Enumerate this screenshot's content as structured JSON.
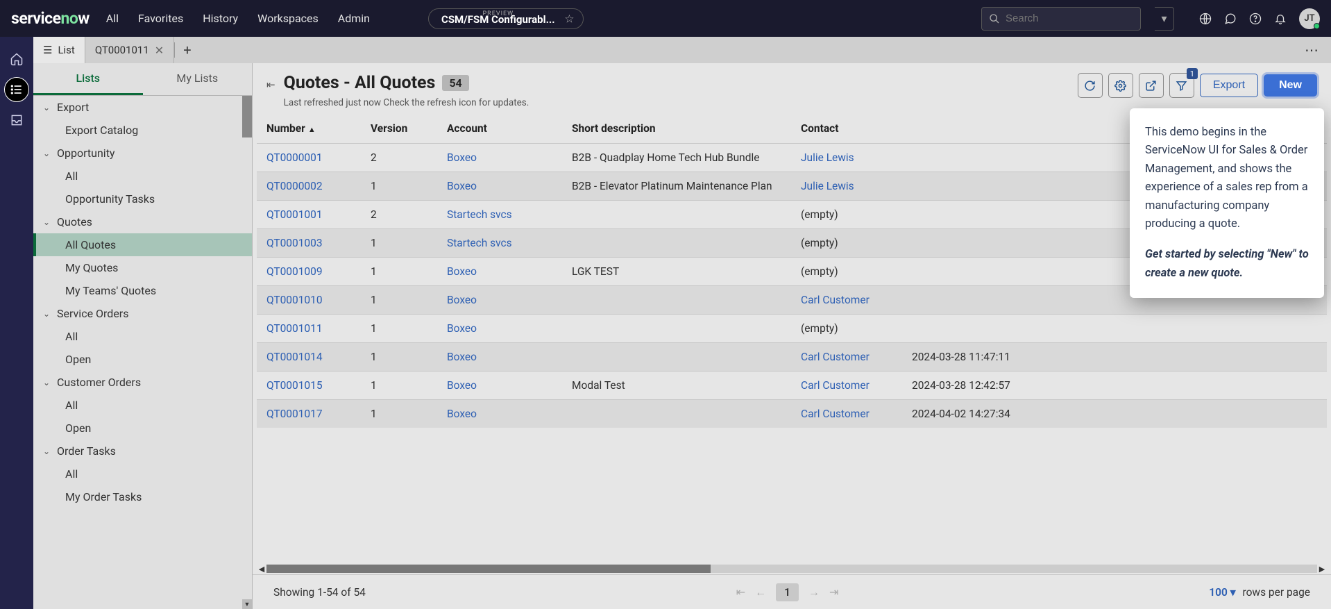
{
  "brand": {
    "name_left": "service",
    "name_right": "w",
    "accent": "no"
  },
  "nav": [
    "All",
    "Favorites",
    "History",
    "Workspaces",
    "Admin"
  ],
  "workspace": {
    "preview": "PREVIEW",
    "title": "CSM/FSM Configurabl..."
  },
  "search": {
    "placeholder": "Search"
  },
  "avatar": "JT",
  "tabs": [
    {
      "label": "List",
      "active": true,
      "icon": true
    },
    {
      "label": "QT0001011",
      "active": false,
      "closeable": true
    }
  ],
  "side_tabs": {
    "lists": "Lists",
    "my_lists": "My Lists"
  },
  "tree": [
    {
      "label": "Export",
      "type": "group"
    },
    {
      "label": "Export Catalog",
      "type": "child"
    },
    {
      "label": "Opportunity",
      "type": "group"
    },
    {
      "label": "All",
      "type": "child"
    },
    {
      "label": "Opportunity Tasks",
      "type": "child"
    },
    {
      "label": "Quotes",
      "type": "group"
    },
    {
      "label": "All Quotes",
      "type": "child",
      "selected": true
    },
    {
      "label": "My Quotes",
      "type": "child"
    },
    {
      "label": "My Teams' Quotes",
      "type": "child"
    },
    {
      "label": "Service Orders",
      "type": "group"
    },
    {
      "label": "All",
      "type": "child"
    },
    {
      "label": "Open",
      "type": "child"
    },
    {
      "label": "Customer Orders",
      "type": "group"
    },
    {
      "label": "All",
      "type": "child"
    },
    {
      "label": "Open",
      "type": "child"
    },
    {
      "label": "Order Tasks",
      "type": "group"
    },
    {
      "label": "All",
      "type": "child"
    },
    {
      "label": "My Order Tasks",
      "type": "child"
    }
  ],
  "header": {
    "title": "Quotes - All Quotes",
    "count": "54",
    "refresh_text": "Last refreshed just now Check the refresh icon for updates.",
    "export": "Export",
    "new": "New",
    "filter_badge": "1"
  },
  "columns": [
    "Number",
    "Version",
    "Account",
    "Short description",
    "Contact",
    ""
  ],
  "rows": [
    {
      "num": "QT0000001",
      "ver": "2",
      "acc": "Boxeo",
      "desc": "B2B - Quadplay Home Tech Hub Bundle",
      "contact": "Julie Lewis",
      "contact_link": true,
      "extra": ""
    },
    {
      "num": "QT0000002",
      "ver": "1",
      "acc": "Boxeo",
      "desc": "B2B - Elevator Platinum Maintenance Plan",
      "contact": "Julie Lewis",
      "contact_link": true,
      "extra": ""
    },
    {
      "num": "QT0001001",
      "ver": "2",
      "acc": "Startech svcs",
      "desc": "",
      "contact": "(empty)",
      "contact_link": false,
      "extra": ""
    },
    {
      "num": "QT0001003",
      "ver": "1",
      "acc": "Startech svcs",
      "desc": "",
      "contact": "(empty)",
      "contact_link": false,
      "extra": ""
    },
    {
      "num": "QT0001009",
      "ver": "1",
      "acc": "Boxeo",
      "desc": "LGK TEST",
      "contact": "(empty)",
      "contact_link": false,
      "extra": ""
    },
    {
      "num": "QT0001010",
      "ver": "1",
      "acc": "Boxeo",
      "desc": "",
      "contact": "Carl Customer",
      "contact_link": true,
      "extra": ""
    },
    {
      "num": "QT0001011",
      "ver": "1",
      "acc": "Boxeo",
      "desc": "",
      "contact": "(empty)",
      "contact_link": false,
      "extra": ""
    },
    {
      "num": "QT0001014",
      "ver": "1",
      "acc": "Boxeo",
      "desc": "",
      "contact": "Carl Customer",
      "contact_link": true,
      "extra": "2024-03-28 11:47:11"
    },
    {
      "num": "QT0001015",
      "ver": "1",
      "acc": "Boxeo",
      "desc": "Modal Test",
      "contact": "Carl Customer",
      "contact_link": true,
      "extra": "2024-03-28 12:42:57"
    },
    {
      "num": "QT0001017",
      "ver": "1",
      "acc": "Boxeo",
      "desc": "",
      "contact": "Carl Customer",
      "contact_link": true,
      "extra": "2024-04-02 14:27:34"
    }
  ],
  "footer": {
    "showing": "Showing 1-54 of 54",
    "page": "1",
    "rpp_value": "100",
    "rpp_label": "rows per page"
  },
  "popover": {
    "p1": "This demo begins in the ServiceNow UI for Sales & Order Management, and shows the experience of a sales rep from a manufacturing company producing a quote.",
    "p2": "Get started by selecting \"New\" to create a new quote."
  }
}
